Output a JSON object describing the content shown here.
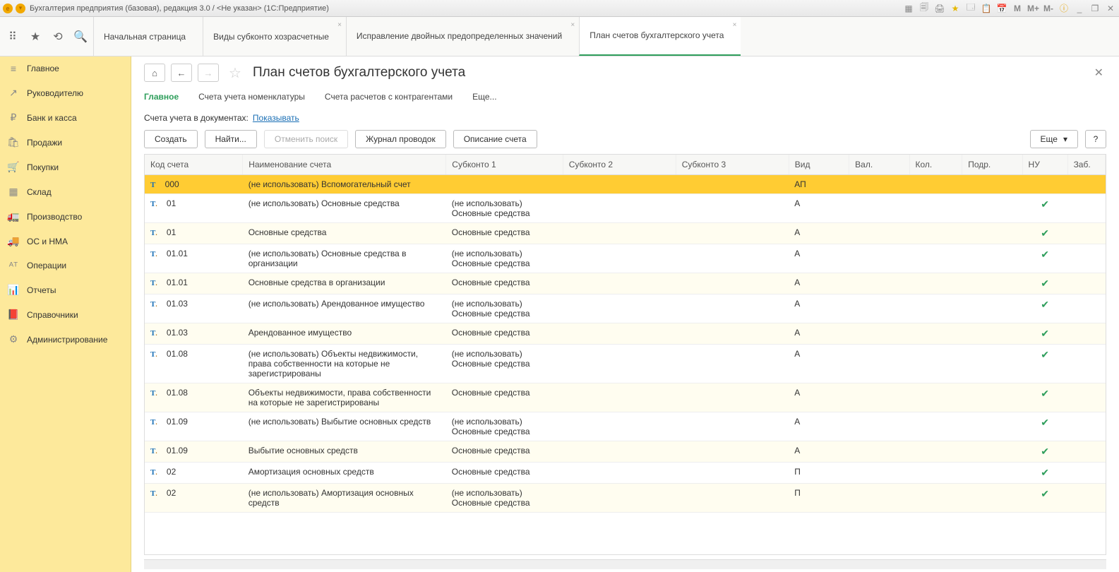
{
  "titlebar": {
    "text": "Бухгалтерия предприятия (базовая), редакция 3.0 / <Не указан>  (1С:Предприятие)",
    "m_buttons": [
      "M",
      "M+",
      "M-"
    ]
  },
  "toolbar": {},
  "tabs": [
    {
      "label": "Начальная страница",
      "closable": false
    },
    {
      "label": "Виды субконто хозрасчетные",
      "closable": true
    },
    {
      "label": "Исправление двойных предопределенных значений",
      "closable": true
    },
    {
      "label": "План счетов бухгалтерского учета",
      "closable": true,
      "active": true
    }
  ],
  "sidebar": [
    {
      "icon": "≡",
      "label": "Главное"
    },
    {
      "icon": "↗",
      "label": "Руководителю"
    },
    {
      "icon": "₽",
      "label": "Банк и касса"
    },
    {
      "icon": "🛍",
      "label": "Продажи"
    },
    {
      "icon": "🛒",
      "label": "Покупки"
    },
    {
      "icon": "▦",
      "label": "Склад"
    },
    {
      "icon": "🚛",
      "label": "Производство"
    },
    {
      "icon": "🚚",
      "label": "ОС и НМА"
    },
    {
      "icon": "ᴬᵀ",
      "label": "Операции"
    },
    {
      "icon": "📊",
      "label": "Отчеты"
    },
    {
      "icon": "📕",
      "label": "Справочники"
    },
    {
      "icon": "⚙",
      "label": "Администрирование"
    }
  ],
  "page": {
    "title": "План счетов бухгалтерского учета",
    "subnav": [
      "Главное",
      "Счета учета номенклатуры",
      "Счета расчетов с контрагентами",
      "Еще..."
    ],
    "info_label": "Счета учета в документах:",
    "info_link": "Показывать",
    "actions": {
      "create": "Создать",
      "find": "Найти...",
      "cancel_search": "Отменить поиск",
      "journal": "Журнал проводок",
      "desc": "Описание счета",
      "more": "Еще",
      "help": "?"
    }
  },
  "table": {
    "headers": [
      "Код счета",
      "Наименование счета",
      "Субконто 1",
      "Субконто 2",
      "Субконто 3",
      "Вид",
      "Вал.",
      "Кол.",
      "Подр.",
      "НУ",
      "Заб."
    ],
    "rows": [
      {
        "sel": true,
        "icon": "T",
        "code": "000",
        "name": "(не использовать) Вспомогательный счет",
        "s1": "",
        "s2": "",
        "s3": "",
        "vid": "АП",
        "nu": false
      },
      {
        "icon": "Ts",
        "code": "01",
        "name": "(не использовать) Основные средства",
        "s1": "(не использовать) Основные средства",
        "vid": "А",
        "nu": true
      },
      {
        "alt": true,
        "icon": "Ts",
        "code": "01",
        "name": "Основные средства",
        "s1": "Основные средства",
        "vid": "А",
        "nu": true
      },
      {
        "icon": "Ts",
        "code": "01.01",
        "name": "(не использовать) Основные средства в организации",
        "s1": "(не использовать) Основные средства",
        "vid": "А",
        "nu": true
      },
      {
        "alt": true,
        "icon": "Ts",
        "code": "01.01",
        "name": "Основные средства в организации",
        "s1": "Основные средства",
        "vid": "А",
        "nu": true
      },
      {
        "icon": "Ts",
        "code": "01.03",
        "name": "(не использовать) Арендованное имущество",
        "s1": "(не использовать) Основные средства",
        "vid": "А",
        "nu": true
      },
      {
        "alt": true,
        "icon": "Ts",
        "code": "01.03",
        "name": "Арендованное имущество",
        "s1": "Основные средства",
        "vid": "А",
        "nu": true
      },
      {
        "icon": "Ts",
        "code": "01.08",
        "name": "(не использовать) Объекты недвижимости, права собственности на которые не зарегистрированы",
        "s1": "(не использовать) Основные средства",
        "vid": "А",
        "nu": true
      },
      {
        "alt": true,
        "icon": "Ts",
        "code": "01.08",
        "name": "Объекты недвижимости, права собственности на которые не зарегистрированы",
        "s1": "Основные средства",
        "vid": "А",
        "nu": true
      },
      {
        "icon": "Ts",
        "code": "01.09",
        "name": "(не использовать) Выбытие основных средств",
        "s1": "(не использовать) Основные средства",
        "vid": "А",
        "nu": true
      },
      {
        "alt": true,
        "icon": "Ts",
        "code": "01.09",
        "name": "Выбытие основных средств",
        "s1": "Основные средства",
        "vid": "А",
        "nu": true
      },
      {
        "icon": "Ts",
        "code": "02",
        "name": "Амортизация основных средств",
        "s1": "Основные средства",
        "vid": "П",
        "nu": true
      },
      {
        "alt": true,
        "icon": "Ts",
        "code": "02",
        "name": "(не использовать) Амортизация основных средств",
        "s1": "(не использовать) Основные средства",
        "vid": "П",
        "nu": true
      }
    ]
  }
}
